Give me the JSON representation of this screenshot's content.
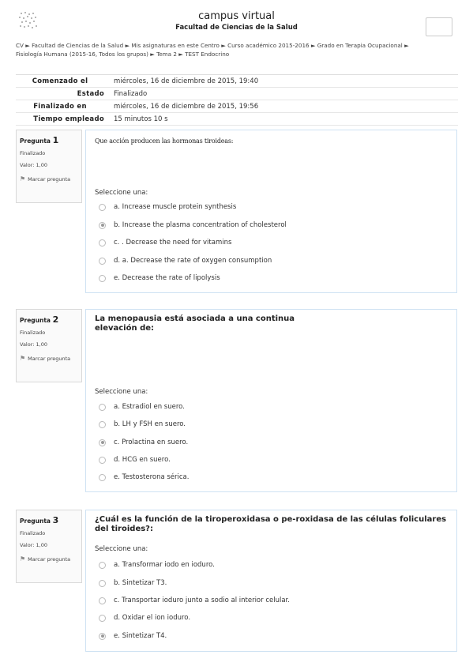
{
  "header": {
    "title": "campus virtual",
    "subtitle": "Facultad de Ciencias de la Salud"
  },
  "breadcrumb": {
    "separator": "►",
    "items": [
      "CV",
      "Facultad de Ciencias de la Salud",
      "Mis asignaturas en este Centro",
      "Curso académico 2015-2016",
      "Grado en Terapia Ocupacional",
      "Fisiología Humana (2015-16, Todos los grupos)",
      "Tema 2",
      "TEST Endocrino"
    ]
  },
  "summary": [
    {
      "label": "Comenzado el",
      "value": "miércoles, 16 de diciembre de 2015, 19:40"
    },
    {
      "label": "Estado",
      "value": "Finalizado"
    },
    {
      "label": "Finalizado en",
      "value": "miércoles, 16 de diciembre de 2015, 19:56"
    },
    {
      "label": "Tiempo empleado",
      "value": "15 minutos 10 s"
    }
  ],
  "questions": [
    {
      "label": "Pregunta",
      "number": "1",
      "state": "Finalizado",
      "grade": "Valor: 1,00",
      "flag_label": "Marcar pregunta",
      "text": "Que acción producen las hormonas tiroideas:",
      "select_label": "Seleccione una:",
      "selected_index": 1,
      "options": [
        "a. Increase muscle protein synthesis",
        "b. Increase the plasma concentration of cholesterol",
        "c. . Decrease the need for vitamins",
        "d. a. Decrease the rate of oxygen consumption",
        "e. Decrease the rate of lipolysis"
      ]
    },
    {
      "label": "Pregunta",
      "number": "2",
      "state": "Finalizado",
      "grade": "Valor: 1,00",
      "flag_label": "Marcar pregunta",
      "text_lines": [
        "La menopausia está asociada a una continua",
        "elevación de:"
      ],
      "select_label": "Seleccione una:",
      "selected_index": 2,
      "options": [
        "a. Estradiol en suero.",
        "b. LH y FSH en suero.",
        "c. Prolactina en suero.",
        "d. HCG en suero.",
        "e. Testosterona sérica."
      ]
    },
    {
      "label": "Pregunta",
      "number": "3",
      "state": "Finalizado",
      "grade": "Valor: 1,00",
      "flag_label": "Marcar pregunta",
      "text_lines": [
        "¿Cuál es la función de la tiroperoxidasa o pe-roxidasa de las células foliculares",
        "del tiroides?:"
      ],
      "select_label": "Seleccione una:",
      "selected_index": 4,
      "options": [
        "a. Transformar iodo en ioduro.",
        "b. Sintetizar T3.",
        "c. Transportar ioduro junto a sodio al interior celular.",
        "d. Oxidar el ion ioduro.",
        "e. Sintetizar T4."
      ]
    }
  ]
}
